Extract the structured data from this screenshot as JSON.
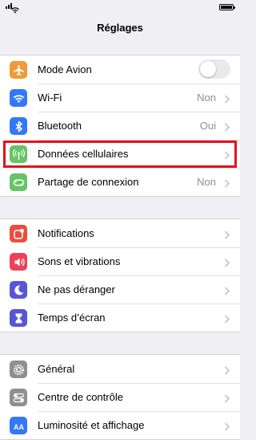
{
  "nav": {
    "title": "Réglages"
  },
  "status_bar": {
    "battery_level": 1.0
  },
  "groups": [
    [
      {
        "label": "Mode Avion",
        "icon": "airplane-icon",
        "color": "#f19a37",
        "toggle": false
      },
      {
        "label": "Wi-Fi",
        "icon": "wifi-icon",
        "color": "#3478f6",
        "value": "Non"
      },
      {
        "label": "Bluetooth",
        "icon": "bluetooth-icon",
        "color": "#3478f6",
        "value": "Oui"
      },
      {
        "label": "Données cellulaires",
        "icon": "antenna-icon",
        "color": "#65c466",
        "highlighted": true
      },
      {
        "label": "Partage de connexion",
        "icon": "hotspot-icon",
        "color": "#65c466",
        "value": "Non"
      }
    ],
    [
      {
        "label": "Notifications",
        "icon": "notifications-icon",
        "color": "#eb4d3d"
      },
      {
        "label": "Sons et vibrations",
        "icon": "speaker-icon",
        "color": "#eb445a"
      },
      {
        "label": "Ne pas déranger",
        "icon": "moon-icon",
        "color": "#5856d6"
      },
      {
        "label": "Temps d’écran",
        "icon": "hourglass-icon",
        "color": "#5856d6"
      }
    ],
    [
      {
        "label": "Général",
        "icon": "gear-icon",
        "color": "#8e8e93"
      },
      {
        "label": "Centre de contrôle",
        "icon": "switches-icon",
        "color": "#8e8e93"
      },
      {
        "label": "Luminosité et affichage",
        "icon": "text-size-icon",
        "color": "#3478f6"
      }
    ]
  ],
  "highlight_color": "#e2131f"
}
